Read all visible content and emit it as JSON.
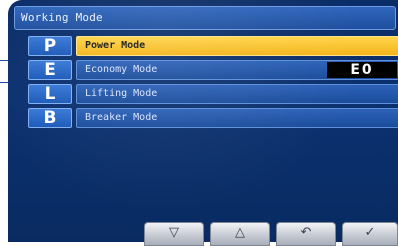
{
  "screen_title": "Working Mode",
  "modes": [
    {
      "letter": "P",
      "label": "Power Mode",
      "selected": true
    },
    {
      "letter": "E",
      "label": "Economy Mode",
      "value": "E0"
    },
    {
      "letter": "L",
      "label": "Lifting Mode"
    },
    {
      "letter": "B",
      "label": "Breaker Mode"
    }
  ],
  "softkeys": {
    "down": "▽",
    "up": "△",
    "back": "↶",
    "confirm": "✓"
  },
  "colors": {
    "selected_bar": "#f6bd24",
    "screen_bg": "#0b2f6b",
    "bar_blue": "#1f52a4"
  }
}
